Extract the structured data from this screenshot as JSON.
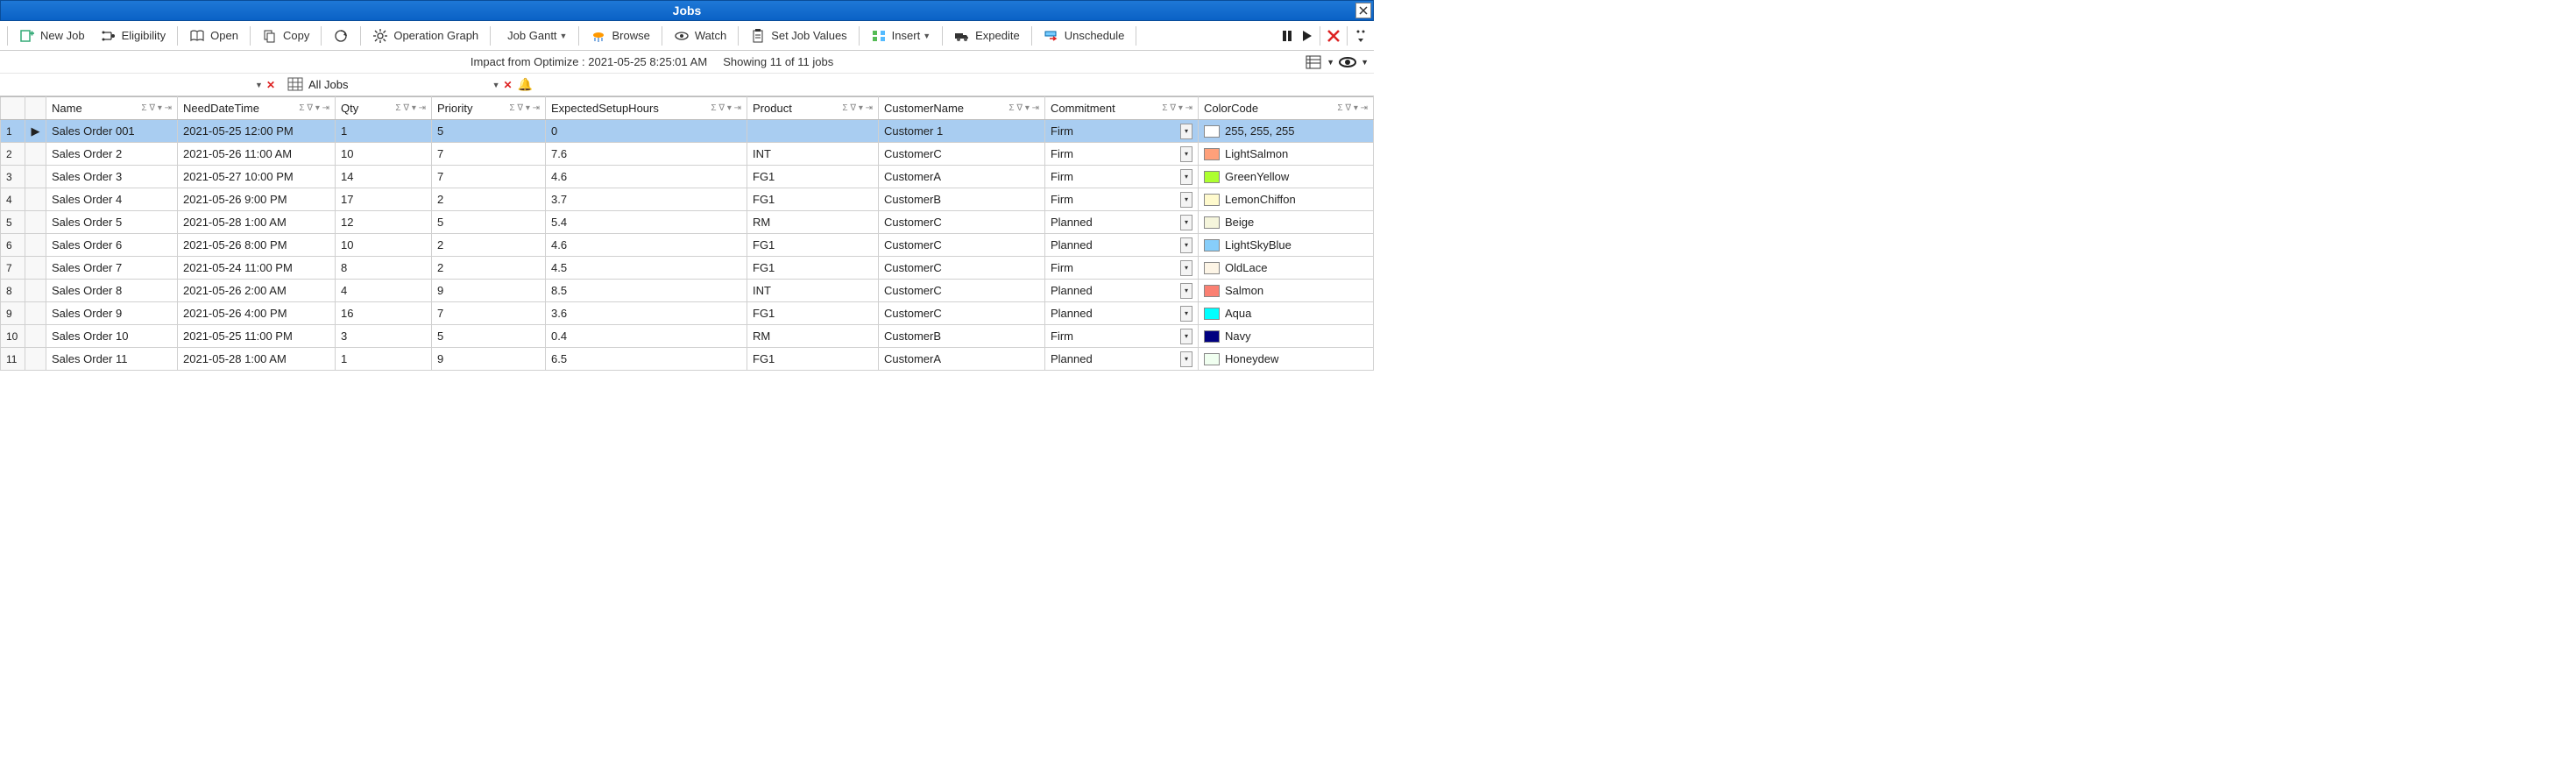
{
  "title": "Jobs",
  "toolbar": {
    "new_job": "New Job",
    "eligibility": "Eligibility",
    "open": "Open",
    "copy": "Copy",
    "operation_graph": "Operation Graph",
    "job_gantt": "Job Gantt",
    "browse": "Browse",
    "watch": "Watch",
    "set_job_values": "Set Job Values",
    "insert": "Insert",
    "expedite": "Expedite",
    "unschedule": "Unschedule"
  },
  "status": {
    "impact": "Impact from Optimize : 2021-05-25 8:25:01 AM",
    "showing": "Showing 11 of 11 jobs"
  },
  "filter_label": "All Jobs",
  "columns": {
    "name": "Name",
    "need": "NeedDateTime",
    "qty": "Qty",
    "priority": "Priority",
    "esh": "ExpectedSetupHours",
    "product": "Product",
    "customer": "CustomerName",
    "commitment": "Commitment",
    "color": "ColorCode"
  },
  "rows": [
    {
      "n": "1",
      "name": "Sales Order 001",
      "need": "2021-05-25 12:00 PM",
      "qty": "1",
      "priority": "5",
      "esh": "0",
      "product": "",
      "customer": "Customer 1",
      "commitment": "Firm",
      "color_label": "255, 255, 255",
      "swatch": "#ffffff",
      "sel": true,
      "marker": true
    },
    {
      "n": "2",
      "name": "Sales Order 2",
      "need": "2021-05-26 11:00 AM",
      "qty": "10",
      "priority": "7",
      "esh": "7.6",
      "product": "INT",
      "customer": "CustomerC",
      "commitment": "Firm",
      "color_label": "LightSalmon",
      "swatch": "#ffa07a"
    },
    {
      "n": "3",
      "name": "Sales Order 3",
      "need": "2021-05-27 10:00 PM",
      "qty": "14",
      "priority": "7",
      "esh": "4.6",
      "product": "FG1",
      "customer": "CustomerA",
      "commitment": "Firm",
      "color_label": "GreenYellow",
      "swatch": "#adff2f"
    },
    {
      "n": "4",
      "name": "Sales Order 4",
      "need": "2021-05-26 9:00 PM",
      "qty": "17",
      "priority": "2",
      "esh": "3.7",
      "product": "FG1",
      "customer": "CustomerB",
      "commitment": "Firm",
      "color_label": "LemonChiffon",
      "swatch": "#fffacd"
    },
    {
      "n": "5",
      "name": "Sales Order 5",
      "need": "2021-05-28 1:00 AM",
      "qty": "12",
      "priority": "5",
      "esh": "5.4",
      "product": "RM",
      "customer": "CustomerC",
      "commitment": "Planned",
      "color_label": "Beige",
      "swatch": "#f5f5dc"
    },
    {
      "n": "6",
      "name": "Sales Order 6",
      "need": "2021-05-26 8:00 PM",
      "qty": "10",
      "priority": "2",
      "esh": "4.6",
      "product": "FG1",
      "customer": "CustomerC",
      "commitment": "Planned",
      "color_label": "LightSkyBlue",
      "swatch": "#87cefa"
    },
    {
      "n": "7",
      "name": "Sales Order 7",
      "need": "2021-05-24 11:00 PM",
      "qty": "8",
      "priority": "2",
      "esh": "4.5",
      "product": "FG1",
      "customer": "CustomerC",
      "commitment": "Firm",
      "color_label": "OldLace",
      "swatch": "#fdf5e6"
    },
    {
      "n": "8",
      "name": "Sales Order 8",
      "need": "2021-05-26 2:00 AM",
      "qty": "4",
      "priority": "9",
      "esh": "8.5",
      "product": "INT",
      "customer": "CustomerC",
      "commitment": "Planned",
      "color_label": "Salmon",
      "swatch": "#fa8072"
    },
    {
      "n": "9",
      "name": "Sales Order 9",
      "need": "2021-05-26 4:00 PM",
      "qty": "16",
      "priority": "7",
      "esh": "3.6",
      "product": "FG1",
      "customer": "CustomerC",
      "commitment": "Planned",
      "color_label": "Aqua",
      "swatch": "#00ffff"
    },
    {
      "n": "10",
      "name": "Sales Order 10",
      "need": "2021-05-25 11:00 PM",
      "qty": "3",
      "priority": "5",
      "esh": "0.4",
      "product": "RM",
      "customer": "CustomerB",
      "commitment": "Firm",
      "color_label": "Navy",
      "swatch": "#000080"
    },
    {
      "n": "11",
      "name": "Sales Order 11",
      "need": "2021-05-28 1:00 AM",
      "qty": "1",
      "priority": "9",
      "esh": "6.5",
      "product": "FG1",
      "customer": "CustomerA",
      "commitment": "Planned",
      "color_label": "Honeydew",
      "swatch": "#f0fff0"
    }
  ]
}
